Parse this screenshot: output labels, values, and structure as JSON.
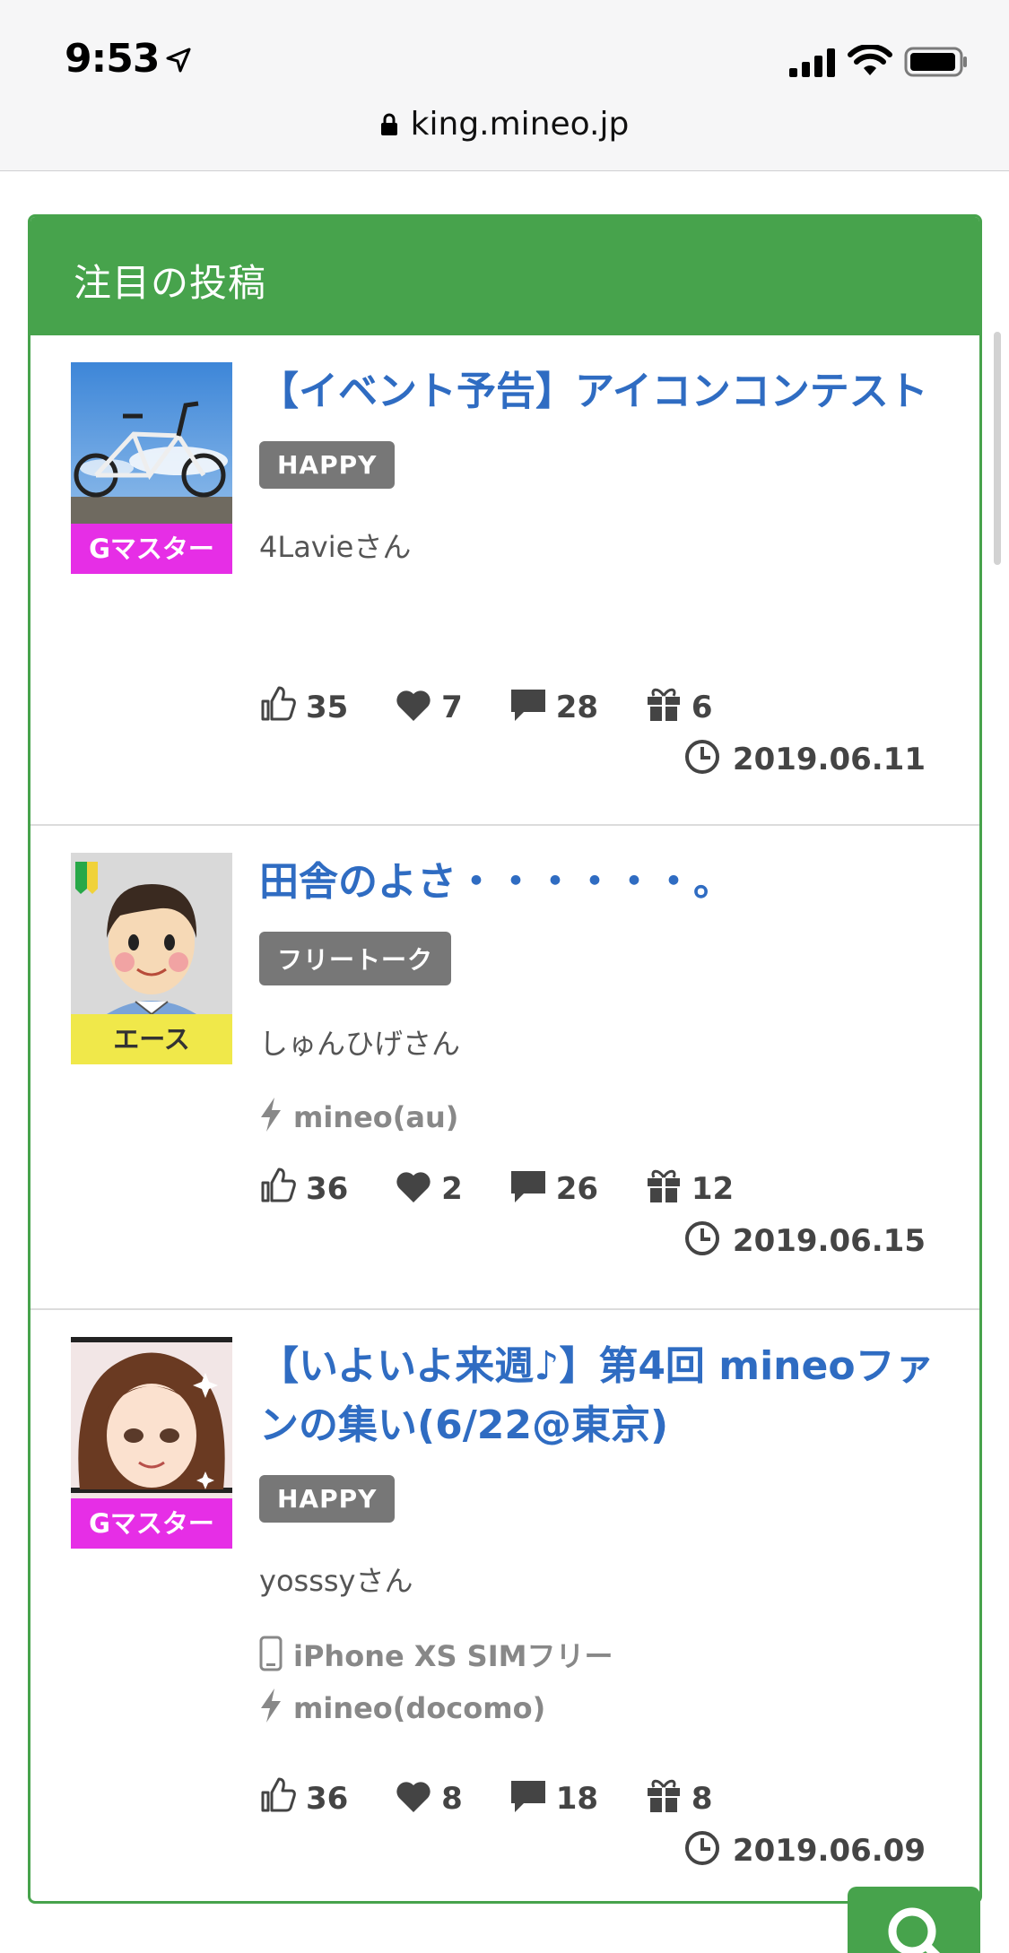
{
  "status_bar": {
    "time": "9:53"
  },
  "browser": {
    "url": "king.mineo.jp"
  },
  "section": {
    "title": "注目の投稿"
  },
  "posts": [
    {
      "title": "【イベント予告】アイコンコンテスト",
      "tag": "HAPPY",
      "rank": "Gマスター",
      "user": "4Lavieさん",
      "device": "",
      "carrier": "",
      "likes": "35",
      "hearts": "7",
      "comments": "28",
      "gifts": "6",
      "date": "2019.06.11"
    },
    {
      "title": "田舎のよさ・・・・・・。",
      "tag": "フリートーク",
      "rank": "エース",
      "user": "しゅんひげさん",
      "device": "",
      "carrier": "mineo(au)",
      "likes": "36",
      "hearts": "2",
      "comments": "26",
      "gifts": "12",
      "date": "2019.06.15"
    },
    {
      "title": "【いよいよ来週♪】第4回 mineoファンの集い(6/22@東京)",
      "tag": "HAPPY",
      "rank": "Gマスター",
      "user": "yosssyさん",
      "device": "iPhone XS SIMフリー",
      "carrier": "mineo(docomo)",
      "likes": "36",
      "hearts": "8",
      "comments": "18",
      "gifts": "8",
      "date": "2019.06.09"
    }
  ],
  "icons": {
    "like": "thumbs-up-icon",
    "heart": "heart-icon",
    "comment": "comment-icon",
    "gift": "gift-icon",
    "clock": "clock-icon",
    "carrier": "lightning-icon",
    "device": "phone-icon",
    "search": "search-icon"
  },
  "colors": {
    "accent": "#47a34c",
    "title": "#2f6cc2",
    "gmaster": "#e62ee6",
    "ace": "#f0e84a",
    "tag": "#777777"
  }
}
